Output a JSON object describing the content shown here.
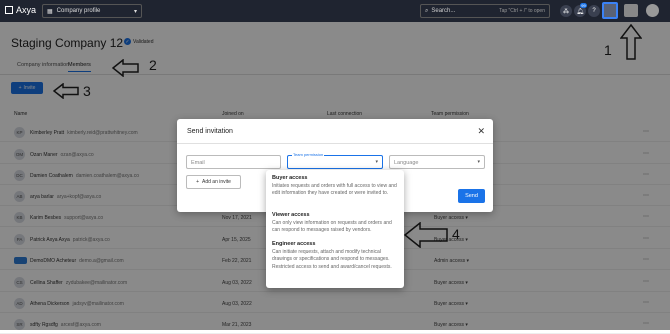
{
  "topbar": {
    "logo_text": "Axya",
    "company_select": "Company profile",
    "search_label": "Search...",
    "search_shortcut": "Tap \"Ctrl + /\" to open",
    "notification_count": "99"
  },
  "page": {
    "title": "Staging Company 12",
    "validated": "Validated",
    "tabs": [
      "Company information",
      "Members"
    ],
    "invite_label": "Invite"
  },
  "table": {
    "headers": [
      "Name",
      "Joined on",
      "Last connection",
      "Team permission"
    ],
    "rows": [
      {
        "initials": "KP",
        "name": "Kimberley Pratt",
        "email": "kimberly.reid@prattwhitney.com",
        "joined": "",
        "permission": ""
      },
      {
        "initials": "OM",
        "name": "Ozan Maner",
        "email": "ozan@axya.co",
        "joined": "",
        "permission": ""
      },
      {
        "initials": "DC",
        "name": "Damien Coathalem",
        "email": "damien.coathalem@axya.co",
        "joined": "",
        "permission": ""
      },
      {
        "initials": "AB",
        "name": "arya barlar",
        "email": "arya+kopf@axya.co",
        "joined": "",
        "permission": ""
      },
      {
        "initials": "KB",
        "name": "Karim Besbes",
        "email": "support@axya.co",
        "joined": "Nov 17, 2021",
        "permission": "Buyer access"
      },
      {
        "initials": "PA",
        "name": "Patrick Axya Axya",
        "email": "patrick@axya.co",
        "joined": "Apr 15, 2025",
        "permission": "Buyer access"
      },
      {
        "initials": "",
        "name": "DemoDMO Acheteur",
        "email": "demo.a@gmail.com",
        "joined": "Feb 22, 2021",
        "permission": "Admin access"
      },
      {
        "initials": "CS",
        "name": "Cellina Shaffer",
        "email": "zydubakee@mailinator.com",
        "joined": "Aug 03, 2022",
        "permission": "Buyer access"
      },
      {
        "initials": "AD",
        "name": "Athena Dickerson",
        "email": "jadsyv@mailinator.com",
        "joined": "Aug 03, 2022",
        "permission": "Buyer access"
      },
      {
        "initials": "SR",
        "name": "sdfty Rgsdfg",
        "email": "arcesf@axya.com",
        "joined": "Mar 21, 2023",
        "permission": "Buyer access"
      }
    ]
  },
  "annotations": [
    "1",
    "2",
    "3",
    "4"
  ],
  "modal": {
    "title": "Send invitation",
    "email_placeholder": "Email",
    "team_label": "Team permission",
    "language_placeholder": "Language",
    "add_invite": "Add an invite",
    "send": "Send"
  },
  "dropdown": {
    "options": [
      {
        "title": "Buyer access",
        "desc": "Initiates requests and orders with full access to view and edit information they have created or were invited to."
      },
      {
        "title": "Viewer access",
        "desc": "Can only view information on requests and orders and can respond to messages raised by vendors."
      },
      {
        "title": "Engineer access",
        "desc": "Can initiate requests, attach and modify technical drawings or specifications and respond to messages. Restricted access to send and award/cancel requests."
      }
    ]
  },
  "colors": {
    "accent": "#1a73e8",
    "topbar": "#1f2430"
  }
}
